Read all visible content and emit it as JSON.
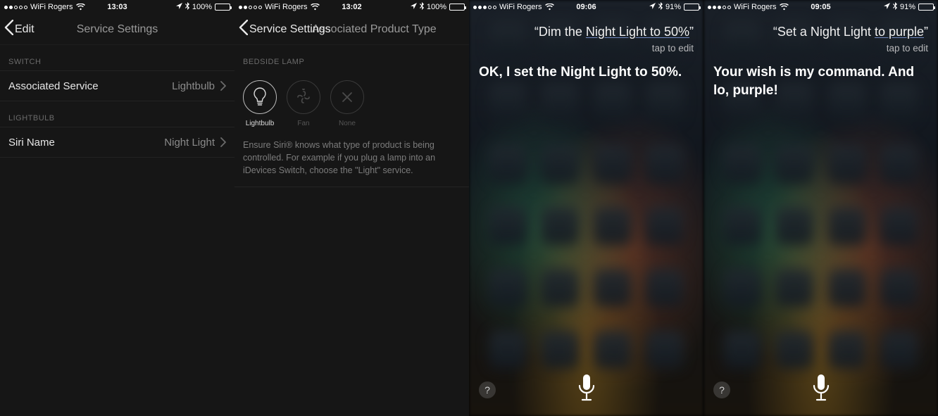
{
  "screens": [
    {
      "status": {
        "carrier": "WiFi Rogers",
        "time": "13:03",
        "battery_pct": "100%",
        "battery_level": 100,
        "signal_filled": 2
      },
      "nav": {
        "back": "Edit",
        "title": "Service Settings"
      },
      "sections": [
        {
          "header": "SWITCH",
          "cell": {
            "label": "Associated Service",
            "value": "Lightbulb"
          }
        },
        {
          "header": "LIGHTBULB",
          "cell": {
            "label": "Siri Name",
            "value": "Night Light"
          }
        }
      ]
    },
    {
      "status": {
        "carrier": "WiFi Rogers",
        "time": "13:02",
        "battery_pct": "100%",
        "battery_level": 100,
        "signal_filled": 2
      },
      "nav": {
        "back": "Service Settings",
        "title": "Associated Product Type"
      },
      "section_header": "BEDSIDE LAMP",
      "types": [
        {
          "label": "Lightbulb",
          "selected": true,
          "icon": "lightbulb"
        },
        {
          "label": "Fan",
          "selected": false,
          "icon": "fan"
        },
        {
          "label": "None",
          "selected": false,
          "icon": "none"
        }
      ],
      "help": "Ensure Siri® knows what type of product is being controlled.  For example if you plug a lamp into an iDevices Switch, choose the \"Light\" service."
    },
    {
      "status": {
        "carrier": "WiFi Rogers",
        "time": "09:06",
        "battery_pct": "91%",
        "battery_level": 91,
        "signal_filled": 3
      },
      "siri": {
        "query_pre": "“Dim the ",
        "query_ul": "Night Light to 50%",
        "query_post": "”",
        "edit": "tap to edit",
        "response": "OK, I set the Night Light to 50%."
      }
    },
    {
      "status": {
        "carrier": "WiFi Rogers",
        "time": "09:05",
        "battery_pct": "91%",
        "battery_level": 91,
        "signal_filled": 3
      },
      "siri": {
        "query_pre": "“Set a Night Light ",
        "query_ul": "to purple",
        "query_post": "”",
        "edit": "tap to edit",
        "response": "Your wish is my command. And lo, purple!"
      }
    }
  ],
  "icons": {
    "help": "?"
  }
}
